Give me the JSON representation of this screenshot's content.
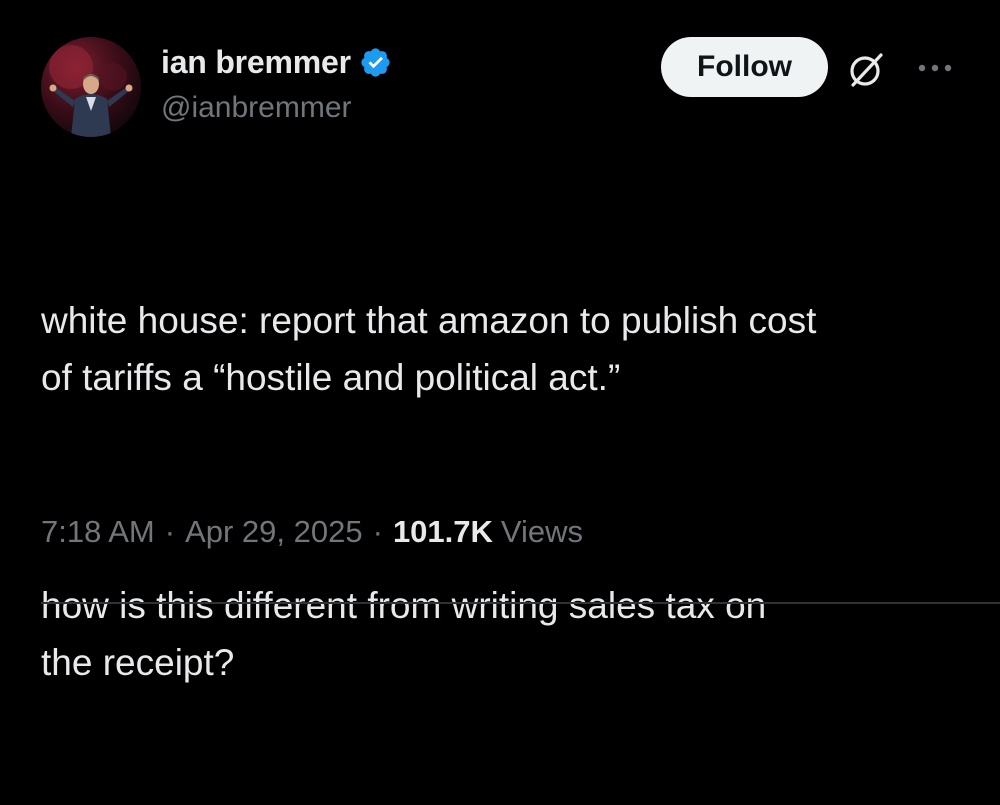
{
  "author": {
    "display_name": "ian bremmer",
    "handle": "@ianbremmer",
    "verified": true,
    "verified_color": "#1d9bf0"
  },
  "actions": {
    "follow_label": "Follow",
    "grok_icon": "grok-icon",
    "more_icon": "more-horizontal-icon"
  },
  "tweet": {
    "text_paragraph_1": "white house: report that amazon to publish cost\nof tariffs a “hostile and political act.”",
    "text_paragraph_2": "how is this different from writing sales tax on\nthe receipt?"
  },
  "meta": {
    "time": "7:18 AM",
    "separator": "·",
    "date": "Apr 29, 2025",
    "views_count": "101.7K",
    "views_label": "Views"
  },
  "colors": {
    "background": "#000000",
    "primary_text": "#e7e9ea",
    "secondary_text": "#71767b",
    "follow_bg": "#eff3f4",
    "follow_text": "#0f1419"
  }
}
